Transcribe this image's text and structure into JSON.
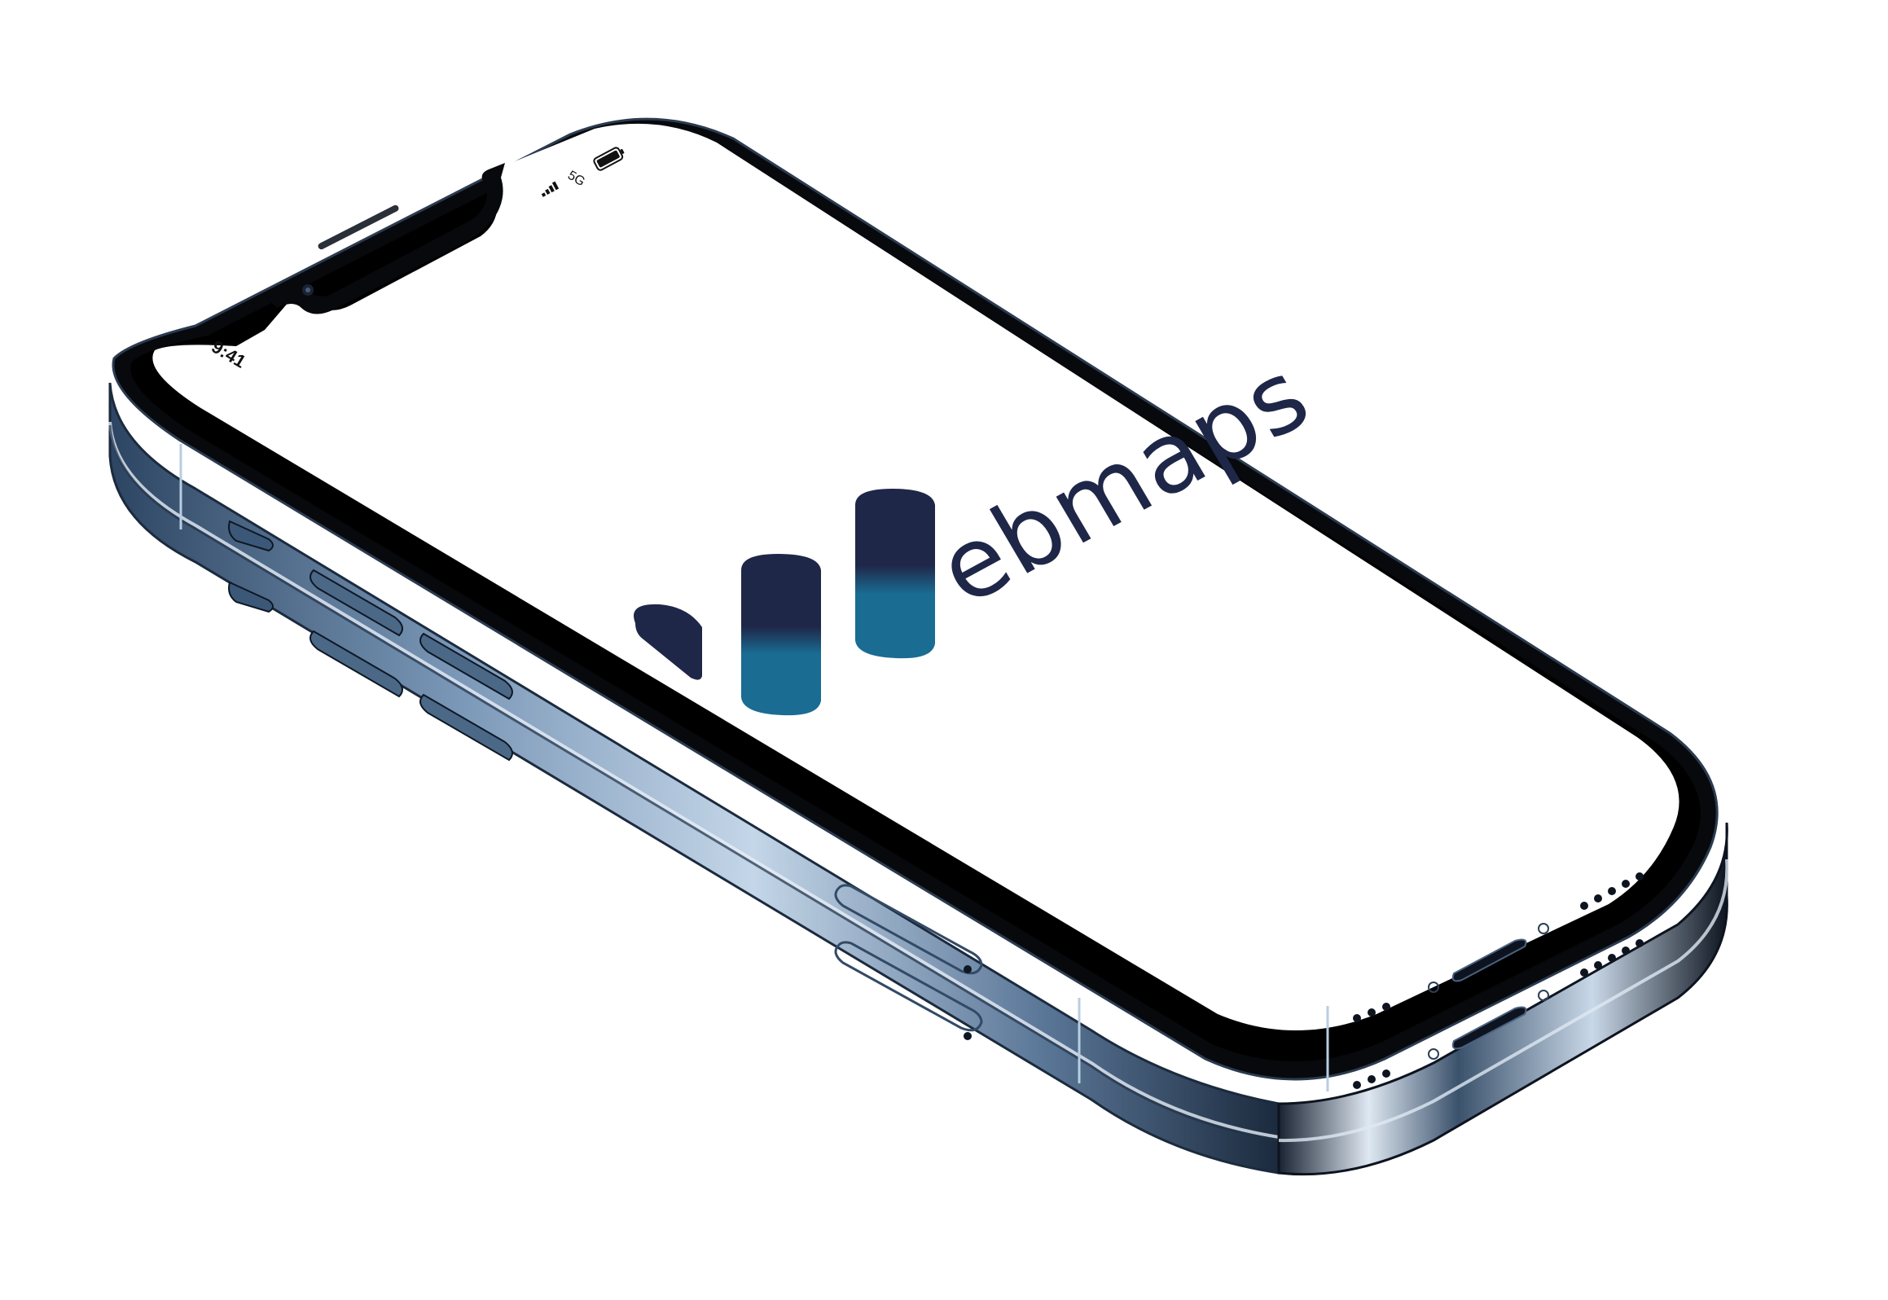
{
  "status_bar": {
    "time": "9:41",
    "network": "5G"
  },
  "brand": {
    "wordmark": "ebmaps",
    "colors": {
      "navy": "#1f2748",
      "teal": "#1a6c93",
      "frame_blue": "#6f90b2"
    }
  }
}
